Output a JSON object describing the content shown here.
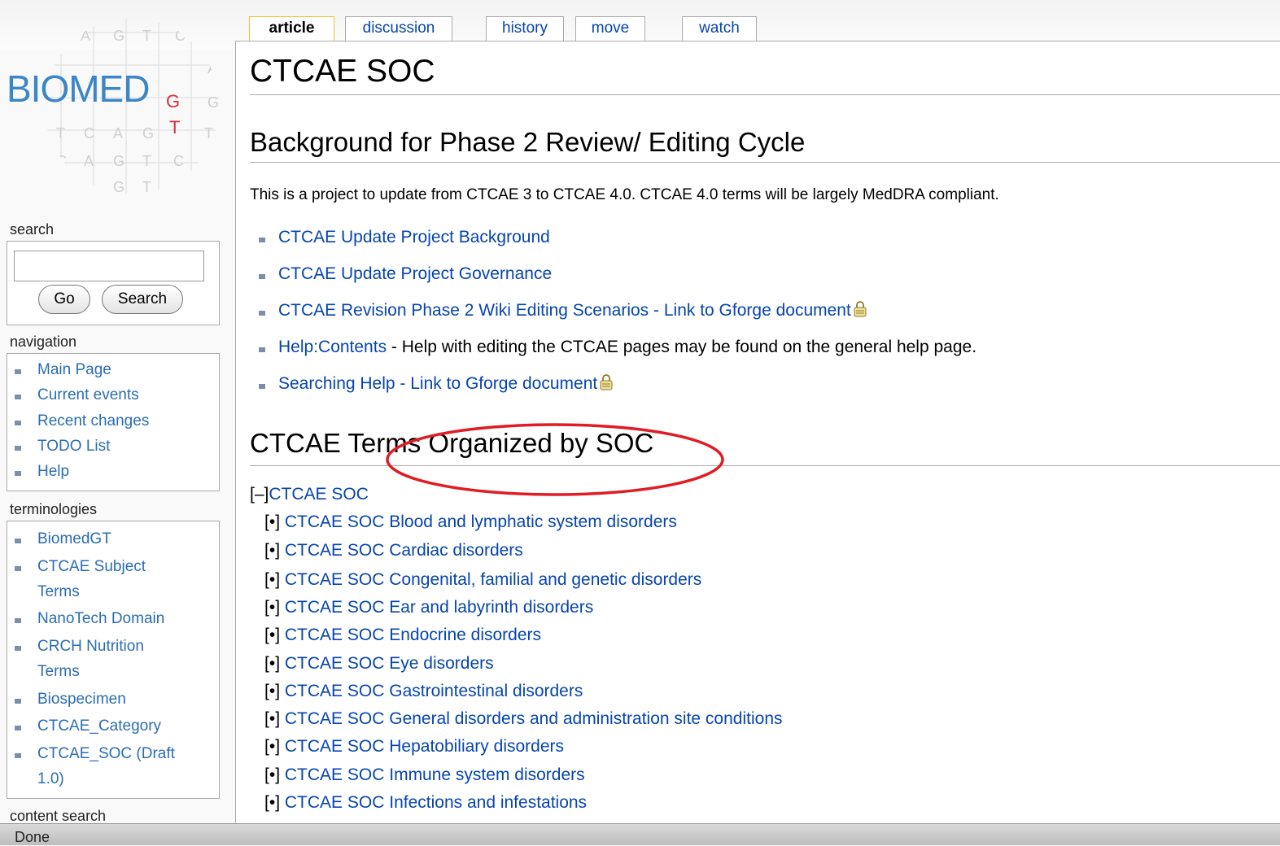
{
  "tabs": [
    {
      "label": "article",
      "selected": true
    },
    {
      "label": "discussion",
      "selected": false
    },
    {
      "label": "history",
      "selected": false
    },
    {
      "label": "move",
      "selected": false
    },
    {
      "label": "watch",
      "selected": false
    }
  ],
  "logo": {
    "word": "BIOMED",
    "sub_g": "G",
    "sub_t": "T",
    "grid_letters": [
      "A",
      "G",
      "T",
      "C",
      "A",
      "G",
      "T",
      "C",
      "A",
      "G",
      "T",
      "C",
      "A",
      "G",
      "T",
      "C",
      "A",
      "G",
      "T",
      "C",
      "A"
    ]
  },
  "sidebar": {
    "search_title": "search",
    "search_value": "",
    "go_label": "Go",
    "search_label": "Search",
    "navigation_title": "navigation",
    "navigation": [
      "Main Page",
      "Current events",
      "Recent changes",
      "TODO List",
      "Help"
    ],
    "terminologies_title": "terminologies",
    "terminologies": [
      "BiomedGT",
      "CTCAE Subject",
      "Terms",
      "NanoTech Domain",
      "CRCH Nutrition",
      "Terms",
      "Biospecimen",
      "CTCAE_Category",
      "CTCAE_SOC (Draft",
      "1.0)"
    ],
    "content_search_title": "content search"
  },
  "page": {
    "title": "CTCAE SOC",
    "section1_heading": "Background for Phase 2 Review/ Editing Cycle",
    "section1_text": "This is a project to update from CTCAE 3 to CTCAE 4.0. CTCAE 4.0 terms will be largely MedDRA compliant.",
    "links": [
      {
        "link": "CTCAE Update Project Background",
        "rest": "",
        "lock": false
      },
      {
        "link": "CTCAE Update Project Governance",
        "rest": "",
        "lock": false
      },
      {
        "link": "CTCAE Revision Phase 2 Wiki Editing Scenarios - Link to Gforge document",
        "rest": "",
        "lock": true
      },
      {
        "link": "Help:Contents",
        "rest": " - Help with editing the CTCAE pages may be found on the general help page.",
        "lock": false
      },
      {
        "link": "Searching Help - Link to Gforge document",
        "rest": "",
        "lock": true
      }
    ],
    "section2_heading": "CTCAE Terms Organized by SOC",
    "tree_root_toggle": "[–]",
    "tree_root": "CTCAE SOC",
    "tree_bullet_open": "[",
    "tree_bullet_dot": "•",
    "tree_bullet_close": "]",
    "tree_items": [
      "CTCAE SOC Blood and lymphatic system disorders",
      "CTCAE SOC Cardiac disorders",
      "CTCAE SOC Congenital, familial and genetic disorders",
      "CTCAE SOC Ear and labyrinth disorders",
      "CTCAE SOC Endocrine disorders",
      "CTCAE SOC Eye disorders",
      "CTCAE SOC Gastrointestinal disorders",
      "CTCAE SOC General disorders and administration site conditions",
      "CTCAE SOC Hepatobiliary disorders",
      "CTCAE SOC Immune system disorders",
      "CTCAE SOC Infections and infestations"
    ]
  },
  "statusbar": {
    "text": "Done"
  },
  "colors": {
    "link": "#0645ad",
    "annotation": "#e01c24",
    "tab_selected_border": "#fabd23"
  }
}
